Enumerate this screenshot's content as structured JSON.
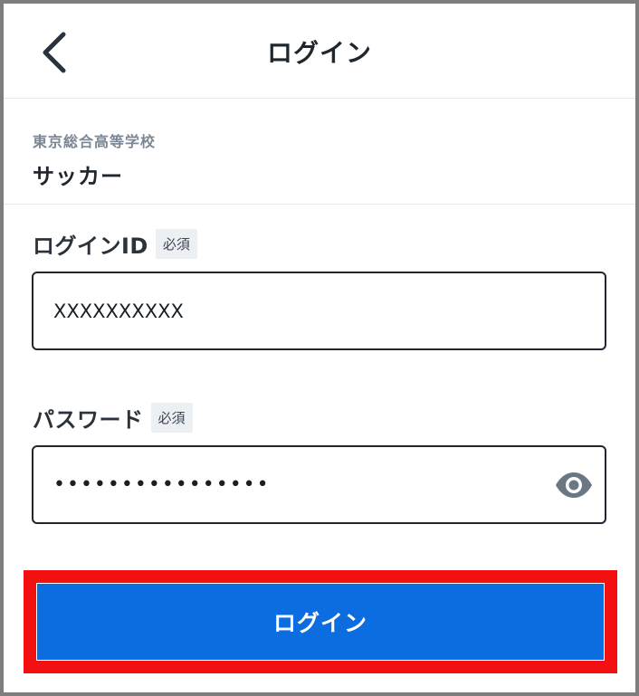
{
  "header": {
    "title": "ログイン",
    "back_icon": "chevron-left-icon"
  },
  "organization": {
    "school": "東京総合高等学校",
    "team": "サッカー"
  },
  "login_id": {
    "label": "ログインID",
    "required_badge": "必須",
    "value": "XXXXXXXXXX"
  },
  "password": {
    "label": "パスワード",
    "required_badge": "必須",
    "masked_value": "••••••••••••••••",
    "toggle_icon": "eye-icon"
  },
  "submit": {
    "label": "ログイン",
    "color": "#0b6ddf",
    "highlight_color": "#f21010"
  }
}
